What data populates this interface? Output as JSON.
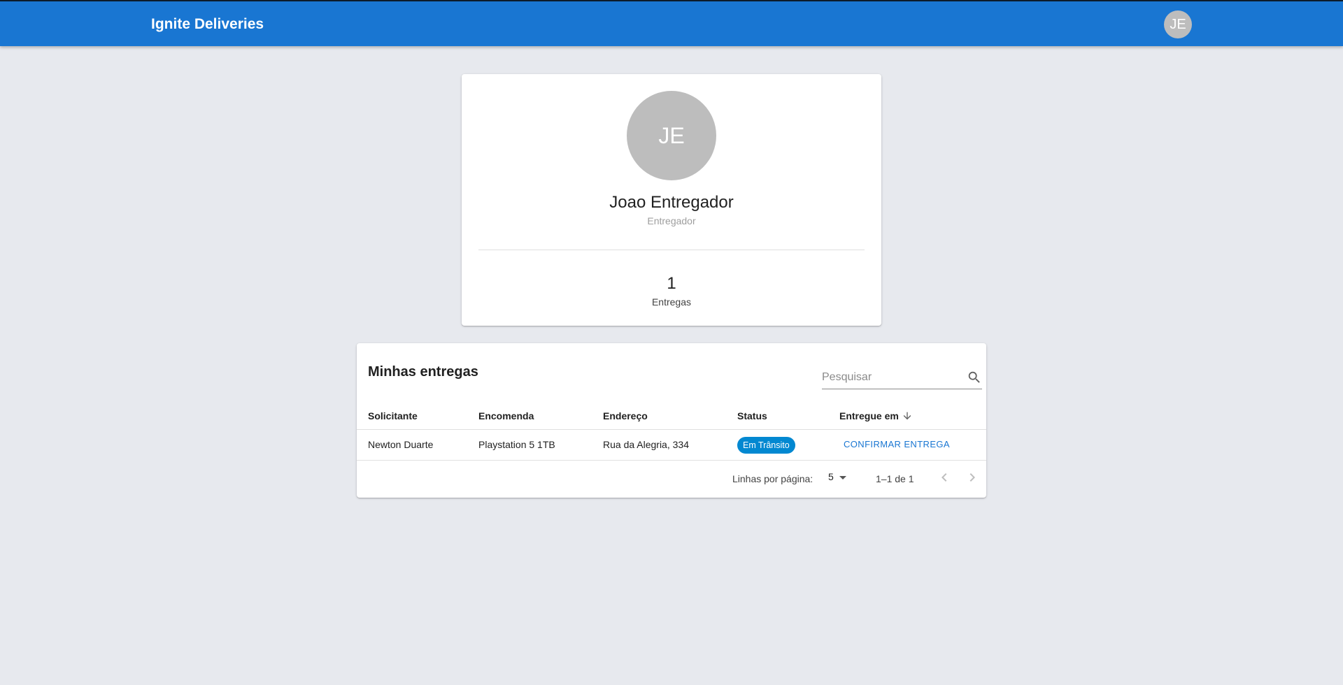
{
  "header": {
    "brand": "Ignite Deliveries",
    "avatar_initials": "JE",
    "color": "#1976d2"
  },
  "profile": {
    "initials": "JE",
    "name": "Joao Entregador",
    "role": "Entregador",
    "deliveries_count": "1",
    "deliveries_label": "Entregas"
  },
  "deliveries": {
    "title": "Minhas entregas",
    "search_placeholder": "Pesquisar",
    "columns": [
      "Solicitante",
      "Encomenda",
      "Endereço",
      "Status",
      "Entregue em"
    ],
    "rows": [
      {
        "requester": "Newton Duarte",
        "item": "Playstation 5 1TB",
        "address": "Rua da Alegria, 334",
        "status": "Em Trânsito",
        "action": "CONFIRMAR ENTREGA"
      }
    ],
    "status_color": "#0288d1"
  },
  "pagination": {
    "rows_per_page_label": "Linhas por página:",
    "rows_per_page_value": "5",
    "range": "1–1 de 1"
  }
}
